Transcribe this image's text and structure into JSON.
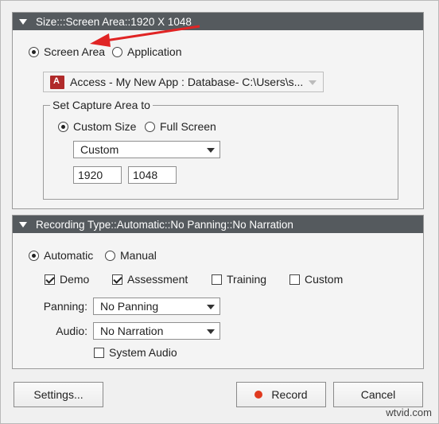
{
  "capture": {
    "header": "Size:::Screen Area::1920 X 1048",
    "mode_screen": "Screen Area",
    "mode_application": "Application",
    "app_select": "Access - My New App : Database- C:\\Users\\s...",
    "group_title": "Set Capture Area to",
    "size_custom": "Custom Size",
    "size_full": "Full Screen",
    "preset_select": "Custom",
    "width": "1920",
    "height": "1048"
  },
  "recording": {
    "header": "Recording Type::Automatic::No Panning::No Narration",
    "automatic": "Automatic",
    "manual": "Manual",
    "demo": "Demo",
    "assessment": "Assessment",
    "training": "Training",
    "custom": "Custom",
    "panning_label": "Panning:",
    "panning_value": "No Panning",
    "audio_label": "Audio:",
    "audio_value": "No Narration",
    "system_audio": "System Audio"
  },
  "buttons": {
    "settings": "Settings...",
    "record": "Record",
    "cancel": "Cancel"
  },
  "watermark": "wtvid.com",
  "colors": {
    "header_bg": "#555a5e",
    "annotation_arrow": "#e02424",
    "record_dot": "#e03a1f"
  }
}
